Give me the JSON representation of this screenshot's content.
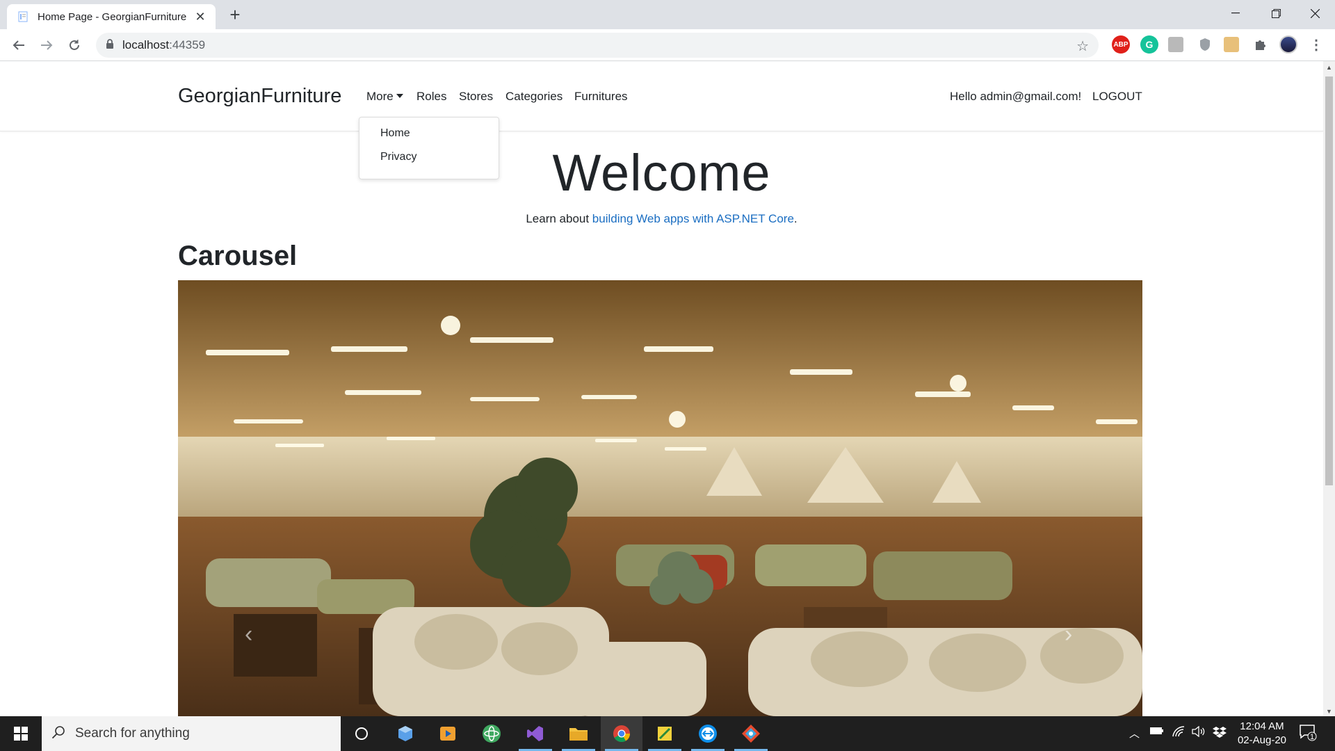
{
  "browser": {
    "tab_title": "Home Page - GeorgianFurniture",
    "url_host": "localhost",
    "url_port": ":44359",
    "extensions": [
      "abp-icon",
      "grammarly-icon",
      "extension-icon",
      "shield-icon",
      "puzzle-icon",
      "profile-avatar"
    ]
  },
  "site": {
    "brand": "GeorgianFurniture",
    "nav": {
      "more": "More",
      "roles": "Roles",
      "stores": "Stores",
      "categories": "Categories",
      "furnitures": "Furnitures"
    },
    "dropdown": [
      "Home",
      "Privacy"
    ],
    "greeting": "Hello admin@gmail.com!",
    "logout": "LOGOUT"
  },
  "main": {
    "welcome": "Welcome",
    "learn_prefix": "Learn about ",
    "learn_link": "building Web apps with ASP.NET Core",
    "learn_suffix": ".",
    "carousel_heading": "Carousel",
    "carousel_prev": "‹",
    "carousel_next": "›"
  },
  "taskbar": {
    "search_placeholder": "Search for anything",
    "time": "12:04 AM",
    "date": "02-Aug-20",
    "notification_count": "1"
  },
  "colors": {
    "link": "#1b6ec2",
    "taskbar": "#1f1f1f"
  }
}
